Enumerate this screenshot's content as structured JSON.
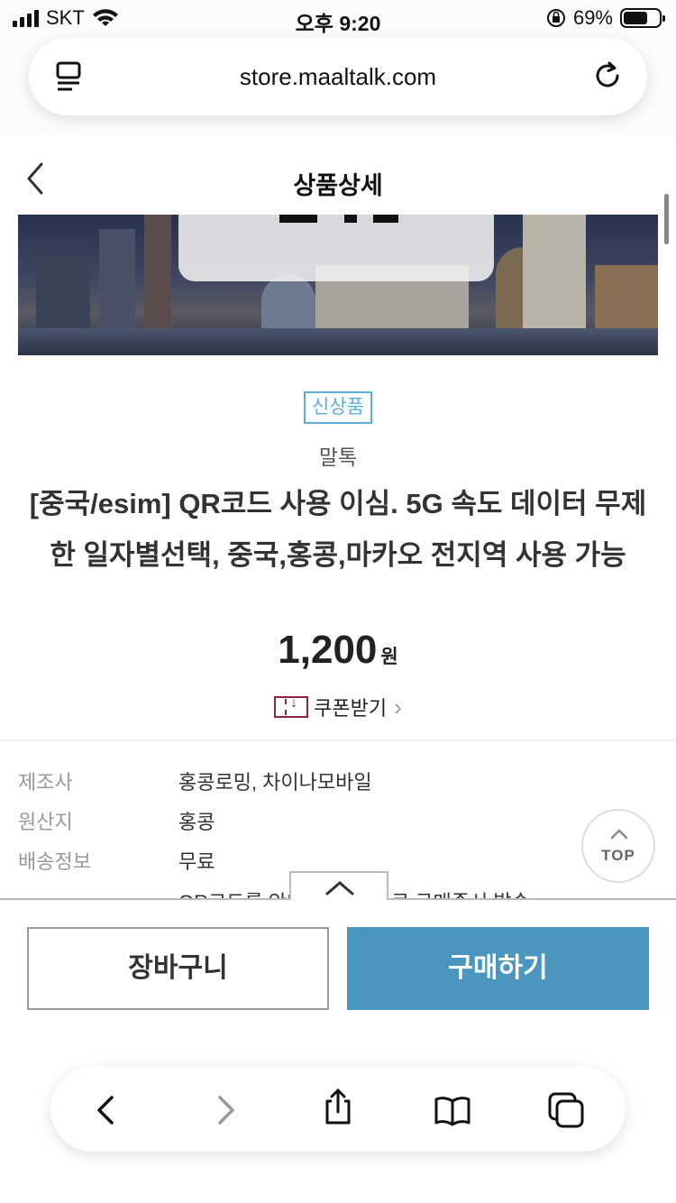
{
  "status_bar": {
    "carrier": "SKT",
    "time": "오후 9:20",
    "battery_percent": "69%",
    "battery_level": 0.69
  },
  "browser": {
    "url": "store.maaltalk.com",
    "icons": {
      "menu": "reader-icon",
      "reload": "reload-icon"
    }
  },
  "header": {
    "title": "상품상세"
  },
  "product": {
    "badge": "신상품",
    "brand": "말톡",
    "name": "[중국/esim] QR코드 사용 이심. 5G 속도 데이터 무제한 일자별선택, 중국,홍콩,마카오 전지역 사용 가능",
    "price": "1,200",
    "currency": "원",
    "coupon_label": "쿠폰받기"
  },
  "info": {
    "rows": [
      {
        "key": "제조사",
        "value": "홍콩로밍, 차이나모바일"
      },
      {
        "key": "원산지",
        "value": "홍콩"
      },
      {
        "key": "배송정보",
        "value": "무료"
      }
    ],
    "partial_text": "QR코드를 안내메일(홍)으로 구매즉시 발송"
  },
  "top_button": "TOP",
  "buttons": {
    "cart": "장바구니",
    "buy": "구매하기"
  },
  "colors": {
    "badge": "#5aaede",
    "buy_button": "#4a96bf",
    "coupon_icon": "#8a2742"
  }
}
